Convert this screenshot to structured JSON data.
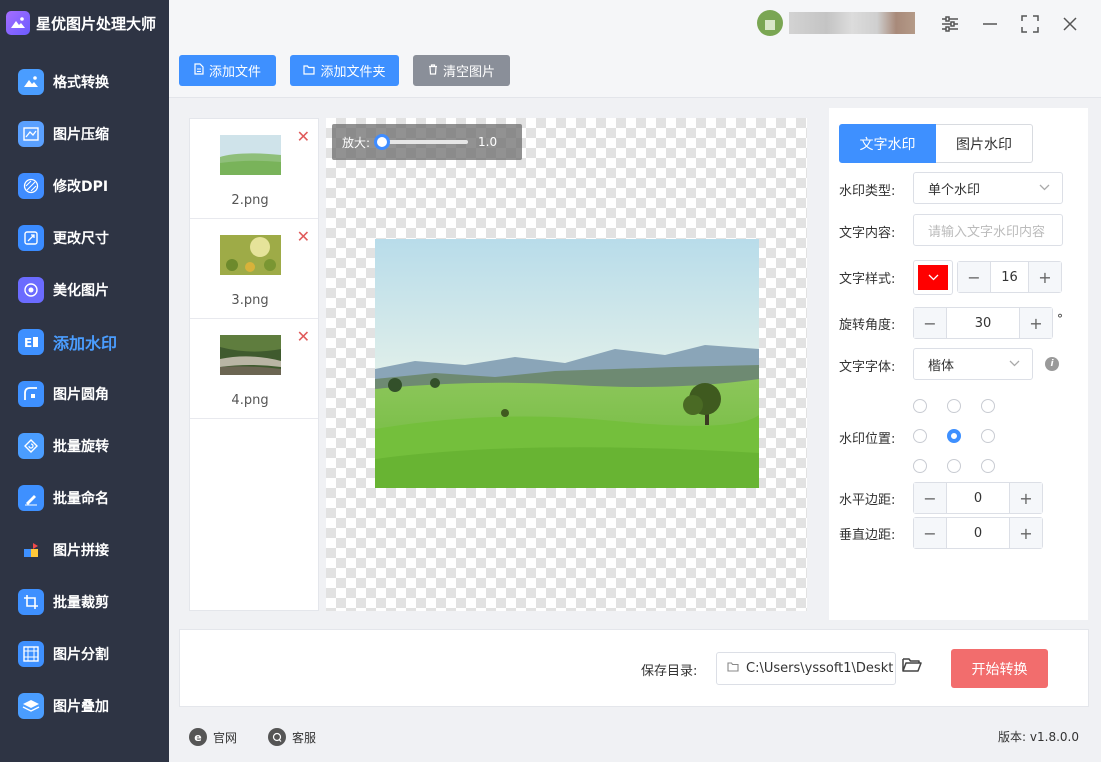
{
  "app": {
    "title": "星优图片处理大师"
  },
  "sidebar": {
    "items": [
      {
        "label": "格式转换",
        "icon": "format-convert-icon",
        "color": "#4a9dff"
      },
      {
        "label": "图片压缩",
        "icon": "compress-icon",
        "color": "#5aa0ff"
      },
      {
        "label": "修改DPI",
        "icon": "dpi-icon",
        "color": "#3f8cff"
      },
      {
        "label": "更改尺寸",
        "icon": "resize-icon",
        "color": "#3a8bff"
      },
      {
        "label": "美化图片",
        "icon": "beautify-icon",
        "color": "#6b6bff"
      },
      {
        "label": "添加水印",
        "icon": "watermark-icon",
        "color": "#3e90ff",
        "active": true
      },
      {
        "label": "图片圆角",
        "icon": "round-corner-icon",
        "color": "#3e90ff"
      },
      {
        "label": "批量旋转",
        "icon": "rotate-icon",
        "color": "#4a9dff"
      },
      {
        "label": "批量命名",
        "icon": "rename-icon",
        "color": "#3e90ff"
      },
      {
        "label": "图片拼接",
        "icon": "splice-icon",
        "color": "#f04a4a"
      },
      {
        "label": "批量裁剪",
        "icon": "crop-icon",
        "color": "#3e90ff"
      },
      {
        "label": "图片分割",
        "icon": "split-icon",
        "color": "#3e90ff"
      },
      {
        "label": "图片叠加",
        "icon": "overlay-icon",
        "color": "#4a9dff"
      }
    ]
  },
  "toolbar": {
    "add_file": "添加文件",
    "add_folder": "添加文件夹",
    "clear": "清空图片",
    "add_color": "#3e90ff",
    "clear_color": "#8a8f99"
  },
  "files": [
    {
      "name": "2.png"
    },
    {
      "name": "3.png"
    },
    {
      "name": "4.png"
    }
  ],
  "preview": {
    "zoom_label": "放大:",
    "zoom_value": "1.0",
    "zoom_fraction": 0
  },
  "watermark": {
    "tab_text": "文字水印",
    "tab_image": "图片水印",
    "type_label": "水印类型:",
    "type_value": "单个水印",
    "content_label": "文字内容:",
    "content_placeholder": "请输入文字水印内容",
    "style_label": "文字样式:",
    "color": "#ff0000",
    "font_size": "16",
    "angle_label": "旋转角度:",
    "angle_value": "30",
    "angle_unit": "°",
    "font_label": "文字字体:",
    "font_value": "楷体",
    "position_label": "水印位置:",
    "position_selected": "middle-center",
    "h_margin_label": "水平边距:",
    "h_margin_value": "0",
    "v_margin_label": "垂直边距:",
    "v_margin_value": "0"
  },
  "output": {
    "save_label": "保存目录:",
    "path": "C:\\Users\\yssoft1\\Deskt",
    "start": "开始转换",
    "start_color": "#f26d6d"
  },
  "footer": {
    "website": "官网",
    "support": "客服",
    "version": "版本: v1.8.0.0"
  }
}
